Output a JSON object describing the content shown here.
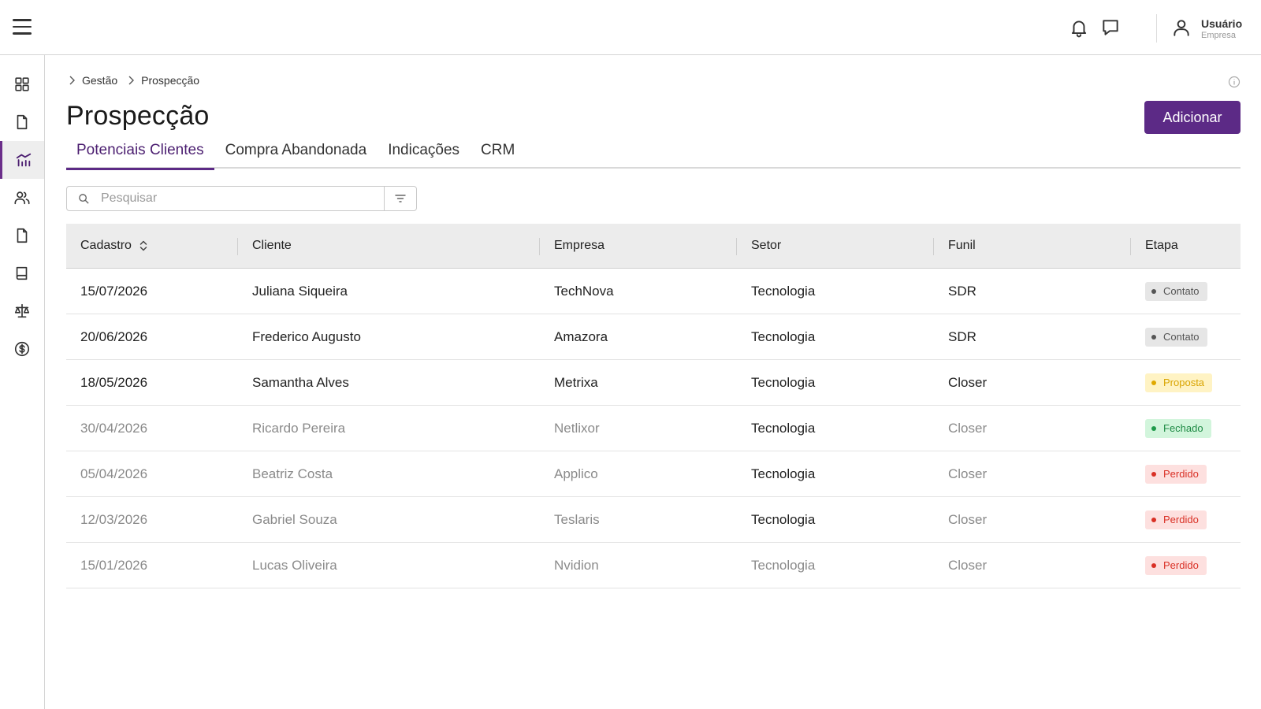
{
  "header": {
    "user_name": "Usuário",
    "user_company": "Empresa"
  },
  "sidebar": {
    "items": [
      {
        "icon": "grid-icon"
      },
      {
        "icon": "document-icon"
      },
      {
        "icon": "funnel-chart-icon",
        "active": true
      },
      {
        "icon": "users-icon"
      },
      {
        "icon": "file-icon"
      },
      {
        "icon": "book-icon"
      },
      {
        "icon": "scale-icon"
      },
      {
        "icon": "dollar-icon"
      }
    ]
  },
  "breadcrumb": {
    "items": [
      "Gestão",
      "Prospecção"
    ]
  },
  "page": {
    "title": "Prospecção",
    "add_label": "Adicionar"
  },
  "tabs": [
    {
      "label": "Potenciais Clientes",
      "active": true
    },
    {
      "label": "Compra Abandonada"
    },
    {
      "label": "Indicações"
    },
    {
      "label": "CRM"
    }
  ],
  "search": {
    "placeholder": "Pesquisar"
  },
  "table": {
    "columns": [
      "Cadastro",
      "Cliente",
      "Empresa",
      "Setor",
      "Funil",
      "Etapa"
    ],
    "rows": [
      {
        "cadastro": "15/07/2026",
        "cliente": "Juliana Siqueira",
        "empresa": "TechNova",
        "setor": "Tecnologia",
        "funil": "SDR",
        "etapa": "Contato",
        "dim": false
      },
      {
        "cadastro": "20/06/2026",
        "cliente": "Frederico Augusto",
        "empresa": "Amazora",
        "setor": "Tecnologia",
        "funil": "SDR",
        "etapa": "Contato",
        "dim": false
      },
      {
        "cadastro": "18/05/2026",
        "cliente": "Samantha Alves",
        "empresa": "Metrixa",
        "setor": "Tecnologia",
        "funil": "Closer",
        "etapa": "Proposta",
        "dim": false
      },
      {
        "cadastro": "30/04/2026",
        "cliente": "Ricardo Pereira",
        "empresa": "Netlixor",
        "setor": "Tecnologia",
        "funil": "Closer",
        "etapa": "Fechado",
        "dim": true
      },
      {
        "cadastro": "05/04/2026",
        "cliente": "Beatriz Costa",
        "empresa": "Applico",
        "setor": "Tecnologia",
        "funil": "Closer",
        "etapa": "Perdido",
        "dim": true
      },
      {
        "cadastro": "12/03/2026",
        "cliente": "Gabriel Souza",
        "empresa": "Teslaris",
        "setor": "Tecnologia",
        "funil": "Closer",
        "etapa": "Perdido",
        "dim": true
      },
      {
        "cadastro": "15/01/2026",
        "cliente": "Lucas Oliveira",
        "empresa": "Nvidion",
        "setor": "Tecnologia",
        "funil": "Closer",
        "etapa": "Perdido",
        "dim": true
      }
    ]
  },
  "badge_colors": {
    "Contato": {
      "bg": "#e6e6e6",
      "fg": "#555555",
      "dot": "#555555"
    },
    "Proposta": {
      "bg": "#fff3c4",
      "fg": "#d9a400",
      "dot": "#e0a800"
    },
    "Fechado": {
      "bg": "#d2f5dc",
      "fg": "#1e8a44",
      "dot": "#1e9a4a"
    },
    "Perdido": {
      "bg": "#fde0df",
      "fg": "#d93025",
      "dot": "#d93025"
    }
  },
  "accent_color": "#5c2a86"
}
